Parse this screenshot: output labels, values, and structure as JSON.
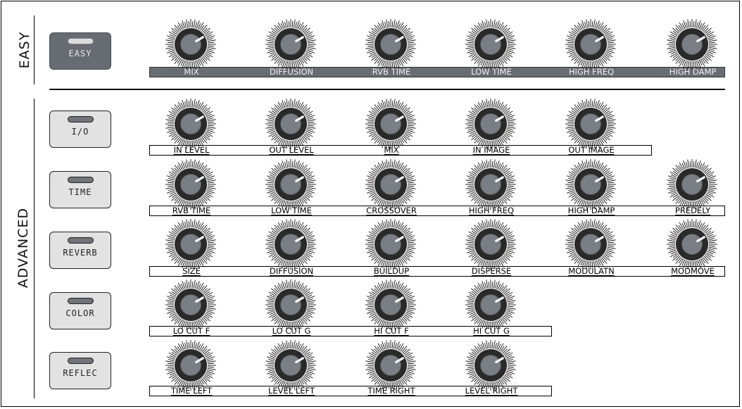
{
  "sections": {
    "easy": "EASY",
    "advanced": "ADVANCED"
  },
  "buttons": {
    "easy": "EASY",
    "io": "I/O",
    "time": "TIME",
    "reverb": "REVERB",
    "color": "COLOR",
    "reflec": "REFLEC"
  },
  "active_mode": "EASY",
  "rows": {
    "easy": [
      "MIX",
      "DIFFUSION",
      "RVB TIME",
      "LOW TIME",
      "HIGH FREQ",
      "HIGH DAMP"
    ],
    "io": [
      "IN LEVEL",
      "OUT LEVEL",
      "MIX",
      "IN IMAGE",
      "OUT IMAGE"
    ],
    "time": [
      "RVB TIME",
      "LOW TIME",
      "CROSSOVER",
      "HIGH FREQ",
      "HIGH DAMP",
      "PREDELY"
    ],
    "reverb": [
      "SIZE",
      "DIFFUSION",
      "BUILDUP",
      "DISPERSE",
      "MODULATN",
      "MODMOVE"
    ],
    "color": [
      "LO CUT F",
      "LO CUT G",
      "HI CUT F",
      "HI CUT G"
    ],
    "reflec": [
      "TIME LEFT",
      "LEVEL LEFT",
      "TIME RIGHT",
      "LEVEL RIGHT"
    ]
  },
  "knob_value_fraction": 0.72,
  "colors": {
    "active_button": "#676b72",
    "inactive_button": "#e2e2e2",
    "knob_body": "#2a2a2a",
    "knob_cap": "#7a7e85",
    "pointer": "#ffffff"
  }
}
